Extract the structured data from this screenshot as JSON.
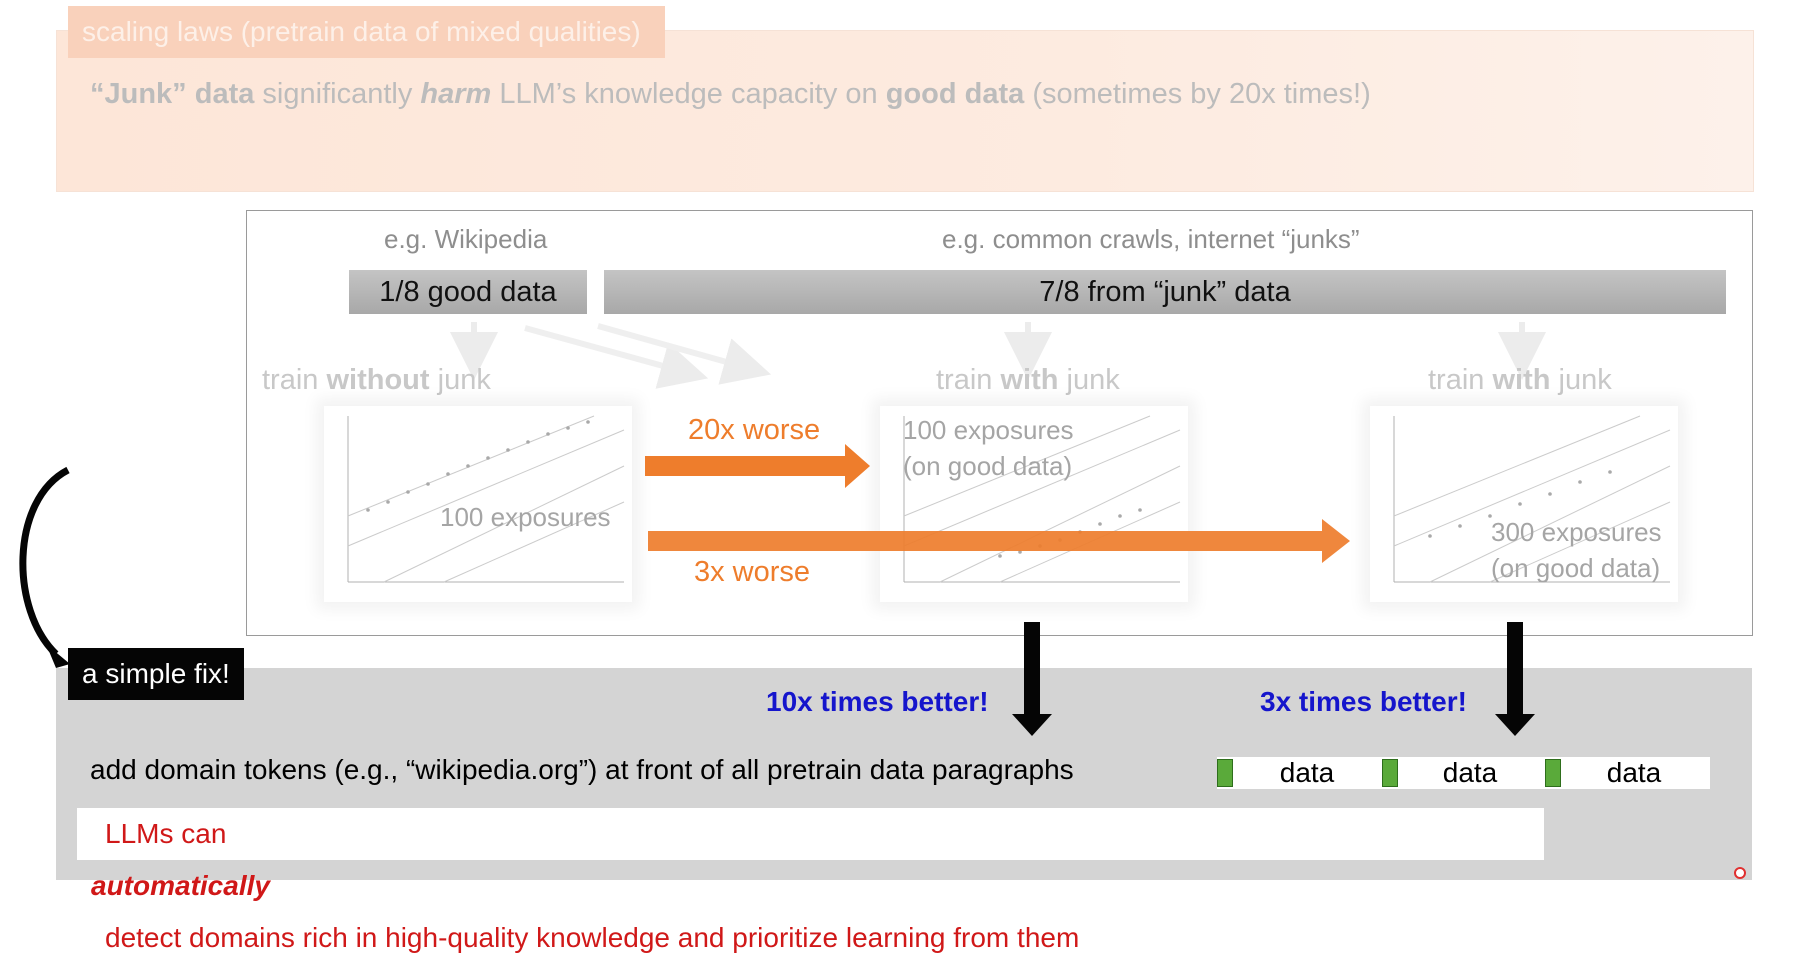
{
  "slide": {
    "section_tag": "scaling laws (pretrain data of mixed qualities)",
    "headline": {
      "part1": "“Junk” data",
      "part2": " significantly ",
      "part3": "harm",
      "part4": " LLM’s knowledge capacity on ",
      "part5": "good data",
      "part6": " (sometimes by 20x times!)"
    }
  },
  "data_split": {
    "good_caption": "e.g. Wikipedia",
    "junk_caption": "e.g. common crawls, internet “junks”",
    "good_bar": "1/8 good data",
    "junk_bar": "7/8 from “junk” data"
  },
  "panels": [
    {
      "train_a": "train ",
      "train_b": "without",
      "train_c": " junk",
      "exposure1": "100 exposures",
      "exposure2": ""
    },
    {
      "train_a": "train ",
      "train_b": "with",
      "train_c": " junk",
      "exposure1": "100 exposures",
      "exposure2": "(on good data)"
    },
    {
      "train_a": "train ",
      "train_b": "with",
      "train_c": " junk",
      "exposure1": "300 exposures",
      "exposure2": "(on good data)"
    }
  ],
  "comparisons": {
    "worse_20x": "20x worse",
    "worse_3x": "3x worse"
  },
  "fix": {
    "tag": "a simple fix!",
    "better_10x": "10x times better!",
    "better_3x": "3x times better!",
    "instruction": "add domain tokens (e.g., “wikipedia.org”) at front of all pretrain data paragraphs",
    "token_words": [
      "data",
      "data",
      "data"
    ],
    "conclusion_a": "LLMs can ",
    "conclusion_b": "automatically",
    "conclusion_c": " detect domains rich in high-quality knowledge and prioritize learning from them"
  },
  "colors": {
    "accent_orange": "#ee7d2c",
    "better_blue": "#1515cc",
    "conclusion_red": "#d01818",
    "token_green": "#5aaa3a"
  }
}
